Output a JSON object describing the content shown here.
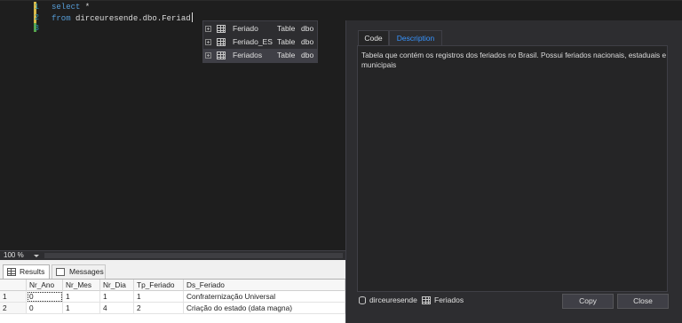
{
  "editor": {
    "lines": [
      {
        "number": "1",
        "keyword": "select",
        "rest": " *"
      },
      {
        "number": "2",
        "keyword": "from",
        "rest": " dirceuresende.dbo.Feriad"
      },
      {
        "number": "3",
        "keyword": "",
        "rest": ""
      }
    ],
    "colors": {
      "keyword": "#569cd6",
      "line_number": "#2b91af",
      "changed_marker": "#d7ba4a",
      "saved_marker": "#57a64a"
    }
  },
  "intellisense": {
    "items": [
      {
        "name": "Feriado",
        "type": "Table",
        "schema": "dbo",
        "icon": "table-icon"
      },
      {
        "name": "Feriado_ES",
        "type": "Table",
        "schema": "dbo",
        "icon": "table-icon"
      },
      {
        "name": "Feriados",
        "type": "Table",
        "schema": "dbo",
        "icon": "table-icon",
        "selected": true
      }
    ]
  },
  "details_panel": {
    "tabs": [
      {
        "label": "Code",
        "active": false
      },
      {
        "label": "Description",
        "active": true
      }
    ],
    "description": "Tabela que contém os registros dos feriados no Brasil. Possui feriados nacionais, estaduais e municipais",
    "database": "dirceuresende",
    "object": "Feriados",
    "copy_label": "Copy",
    "close_label": "Close",
    "accent_color": "#3794ff"
  },
  "statusbar": {
    "zoom": "100 %"
  },
  "results": {
    "tabs": [
      {
        "label": "Results",
        "icon": "grid-icon",
        "active": true
      },
      {
        "label": "Messages",
        "icon": "messages-icon",
        "active": false
      }
    ],
    "columns": [
      "Nr_Ano",
      "Nr_Mes",
      "Nr_Dia",
      "Tp_Feriado",
      "Ds_Feriado"
    ],
    "rows": [
      {
        "num": "1",
        "cells": [
          "0",
          "1",
          "1",
          "1",
          "Confraternização Universal"
        ]
      },
      {
        "num": "2",
        "cells": [
          "0",
          "1",
          "4",
          "2",
          "Criação do estado (data magna)"
        ]
      }
    ]
  }
}
